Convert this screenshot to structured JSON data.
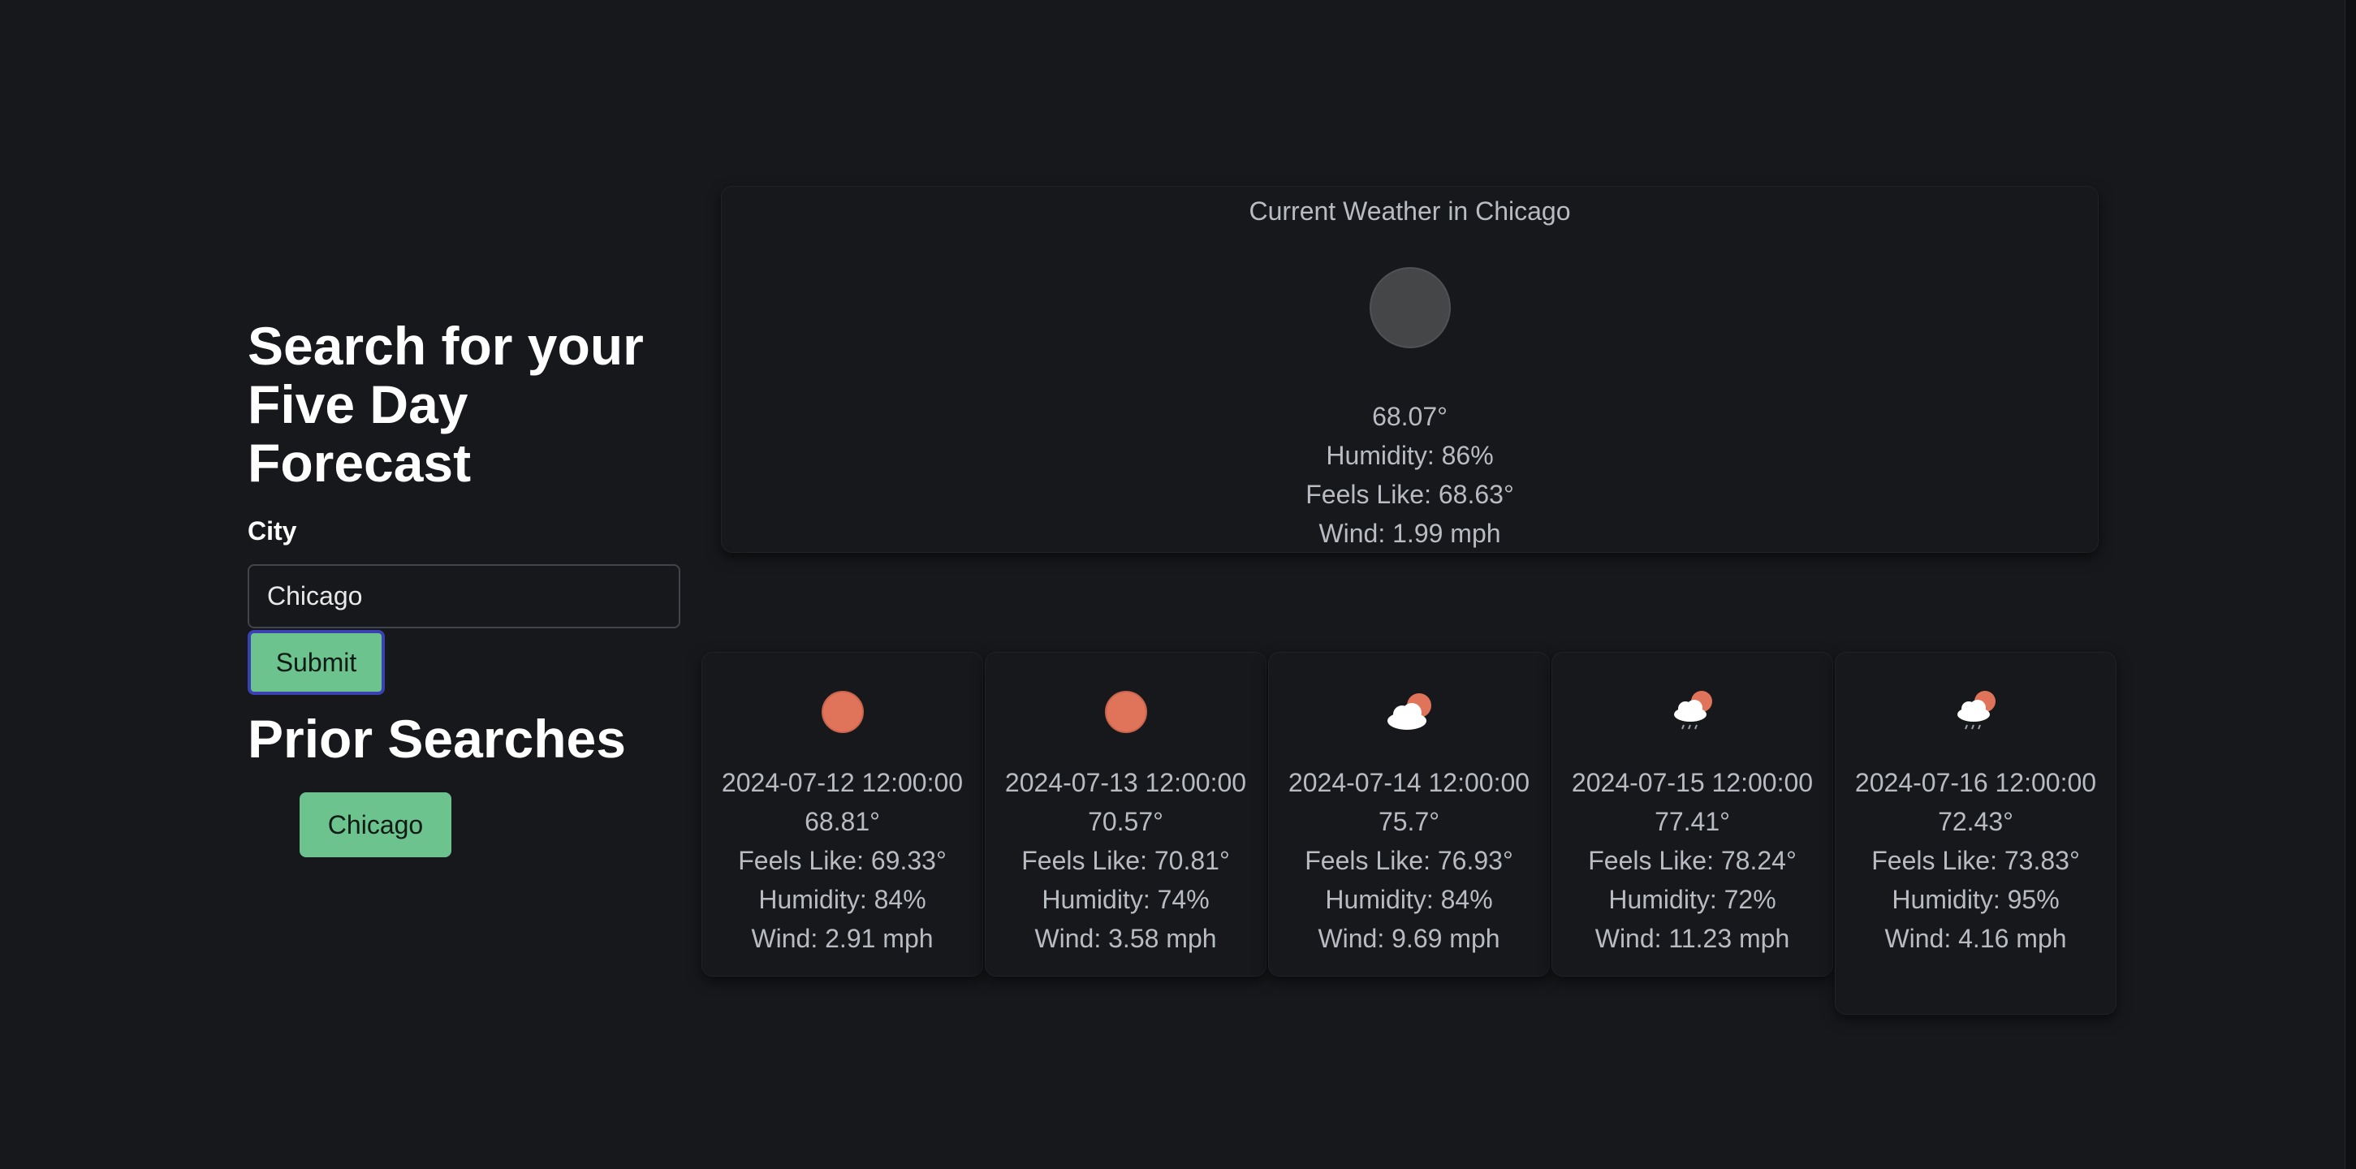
{
  "search": {
    "heading": "Search for your Five Day Forecast",
    "city_label": "City",
    "city_value": "Chicago",
    "submit_label": "Submit"
  },
  "prior": {
    "heading": "Prior Searches",
    "items": [
      "Chicago"
    ]
  },
  "current": {
    "title": "Current Weather in Chicago",
    "icon": "moon-icon",
    "temp": "68.07°",
    "humidity": "Humidity: 86%",
    "feels_like": "Feels Like: 68.63°",
    "wind": "Wind: 1.99 mph"
  },
  "forecast": [
    {
      "date": "2024-07-12 12:00:00",
      "temp": "68.81°",
      "feels_like": "Feels Like: 69.33°",
      "humidity": "Humidity: 84%",
      "wind": "Wind: 2.91 mph",
      "icon": "sun-icon"
    },
    {
      "date": "2024-07-13 12:00:00",
      "temp": "70.57°",
      "feels_like": "Feels Like: 70.81°",
      "humidity": "Humidity: 74%",
      "wind": "Wind: 3.58 mph",
      "icon": "sun-icon"
    },
    {
      "date": "2024-07-14 12:00:00",
      "temp": "75.7°",
      "feels_like": "Feels Like: 76.93°",
      "humidity": "Humidity: 84%",
      "wind": "Wind: 9.69 mph",
      "icon": "partly-cloudy-icon"
    },
    {
      "date": "2024-07-15 12:00:00",
      "temp": "77.41°",
      "feels_like": "Feels Like: 78.24°",
      "humidity": "Humidity: 72%",
      "wind": "Wind: 11.23 mph",
      "icon": "rain-sun-icon"
    },
    {
      "date": "2024-07-16 12:00:00",
      "temp": "72.43°",
      "feels_like": "Feels Like: 73.83°",
      "humidity": "Humidity: 95%",
      "wind": "Wind: 4.16 mph",
      "icon": "rain-sun-icon"
    }
  ],
  "colors": {
    "background": "#16181b",
    "accent_green": "#6cc38e",
    "focus_ring": "#3a42b3",
    "sun": "#e0745a"
  }
}
